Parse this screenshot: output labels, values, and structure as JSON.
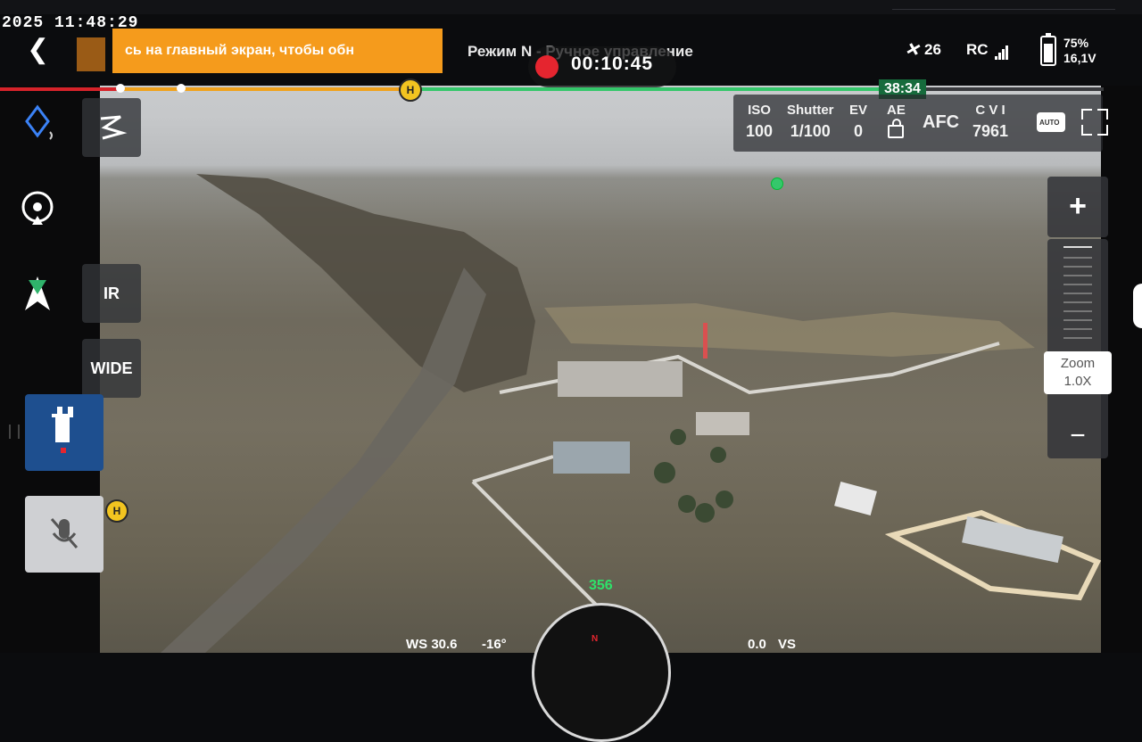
{
  "status_bar": {
    "clock": "2025 11:48:29",
    "banner_text": "сь на главный экран, чтобы обн",
    "mode_text": "Режим N - Ручное управление",
    "recording_time": "00:10:45",
    "satellites": "26",
    "rc_label": "RC",
    "battery_percent": "75%",
    "battery_voltage": "16,1V"
  },
  "flight_progress": {
    "remaining_time": "38:34",
    "home_marker": "H"
  },
  "camera": {
    "iso_label": "ISO",
    "iso_value": "100",
    "shutter_label": "Shutter",
    "shutter_value": "1/100",
    "ev_label": "EV",
    "ev_value": "0",
    "ae_label": "AE",
    "focus_mode": "AFC",
    "storage_label": "C V I",
    "storage_value": "7961"
  },
  "left_controls": {
    "ir_label": "IR",
    "wide_label": "WIDE",
    "home_marker": "H"
  },
  "zoom": {
    "plus": "+",
    "label": "Zoom",
    "value": "1.0X",
    "minus": "−"
  },
  "hud": {
    "heading": "356",
    "wind": "WS 30.6",
    "gimbal": "-16°",
    "vs_value": "0.0",
    "vs_label": "VS"
  },
  "colors": {
    "record": "#e5252f",
    "banner": "#f59b1c",
    "progress_green": "#35c76b",
    "progress_orange": "#f0a21c",
    "remaining_bg": "#166b3c",
    "active_button": "#1e4f8f"
  }
}
